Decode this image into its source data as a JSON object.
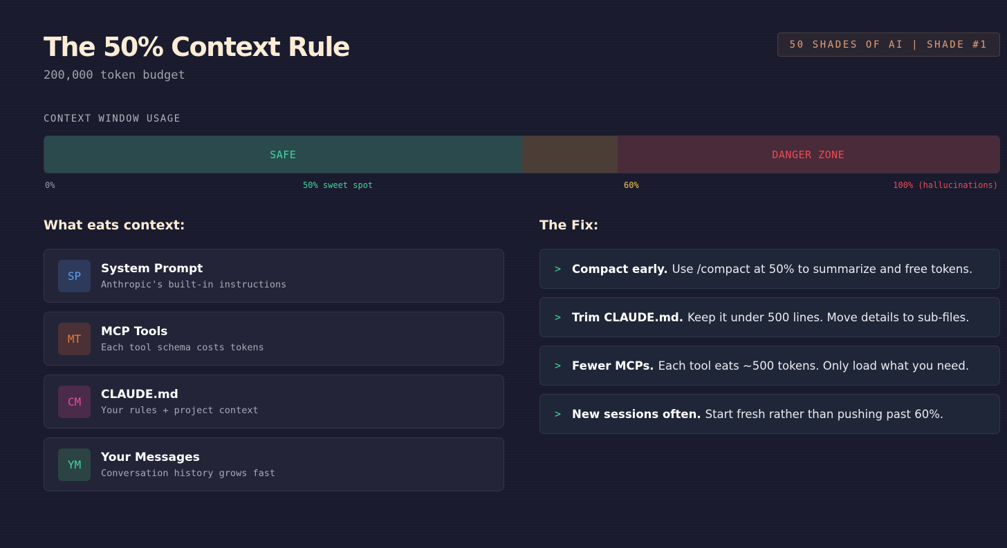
{
  "header": {
    "title": "The 50% Context Rule",
    "subtitle": "200,000 token budget",
    "badge": "50 SHADES OF AI | SHADE #1"
  },
  "usage": {
    "label": "CONTEXT WINDOW USAGE",
    "safe_fraction": 0.5,
    "warning_fraction": 0.1,
    "danger_fraction": 0.4,
    "safe_label": "SAFE",
    "danger_label": "DANGER ZONE",
    "markers": {
      "start": "0%",
      "sweet_spot": "50% sweet spot",
      "warning": "60%",
      "end": "100% (hallucinations)"
    }
  },
  "colors": {
    "accent_green": "#3fd7a0",
    "accent_yellow": "#f2c94c",
    "accent_red": "#ef4a55"
  },
  "eats": {
    "heading": "What eats context:",
    "items": [
      {
        "abbr": "SP",
        "title": "System Prompt",
        "desc": "Anthropic's built-in instructions",
        "tile_bg": "#2d3a5c",
        "tile_fg": "#5ea0f0"
      },
      {
        "abbr": "MT",
        "title": "MCP Tools",
        "desc": "Each tool schema costs tokens",
        "tile_bg": "#4a3136",
        "tile_fg": "#e8793e"
      },
      {
        "abbr": "CM",
        "title": "CLAUDE.md",
        "desc": "Your rules + project context",
        "tile_bg": "#4a2b4a",
        "tile_fg": "#e04fa0"
      },
      {
        "abbr": "YM",
        "title": "Your Messages",
        "desc": "Conversation history grows fast",
        "tile_bg": "#2b4443",
        "tile_fg": "#3fd7a0"
      }
    ]
  },
  "fix": {
    "heading": "The Fix:",
    "chevron": ">",
    "items": [
      {
        "bold": "Compact early.",
        "text": "Use /compact at 50% to summarize and free tokens."
      },
      {
        "bold": "Trim CLAUDE.md.",
        "text": "Keep it under 500 lines. Move details to sub-files."
      },
      {
        "bold": "Fewer MCPs.",
        "text": "Each tool eats ~500 tokens. Only load what you need."
      },
      {
        "bold": "New sessions often.",
        "text": "Start fresh rather than pushing past 60%."
      }
    ]
  }
}
